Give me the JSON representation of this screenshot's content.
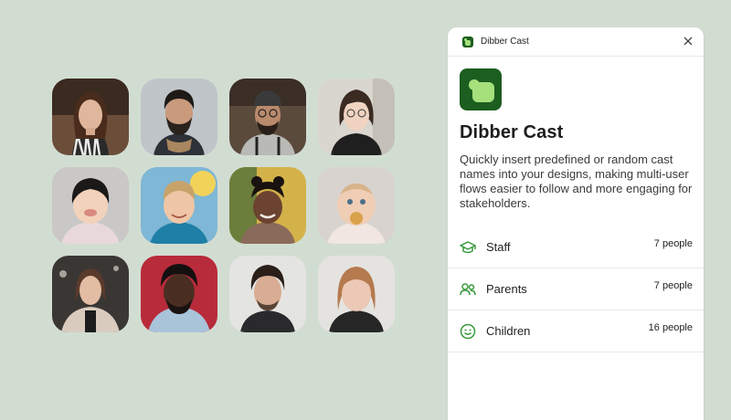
{
  "colors": {
    "background": "#d2ddd2",
    "brand": "#1b5e20",
    "accent_green": "#3a9a3e"
  },
  "avatars": [
    {
      "name": "woman-long-hair"
    },
    {
      "name": "man-beard-scarf"
    },
    {
      "name": "man-beanie-glasses"
    },
    {
      "name": "woman-glasses"
    },
    {
      "name": "toddler-asian"
    },
    {
      "name": "boy-smiling"
    },
    {
      "name": "girl-smiling"
    },
    {
      "name": "baby-blue-eyes"
    },
    {
      "name": "woman-coat"
    },
    {
      "name": "man-curly-hair"
    },
    {
      "name": "man-dark-hair"
    },
    {
      "name": "woman-red-hair"
    }
  ],
  "panel": {
    "window_title": "Dibber Cast",
    "close_icon": "close-icon",
    "app_title": "Dibber Cast",
    "description": "Quickly insert predefined or random cast names into your designs, making multi-user flows easier to follow and more engaging for stakeholders.",
    "groups": [
      {
        "icon": "graduation-cap-icon",
        "label": "Staff",
        "count": "7 people"
      },
      {
        "icon": "people-icon",
        "label": "Parents",
        "count": "7 people"
      },
      {
        "icon": "smiley-icon",
        "label": "Children",
        "count": "16 people"
      }
    ]
  }
}
